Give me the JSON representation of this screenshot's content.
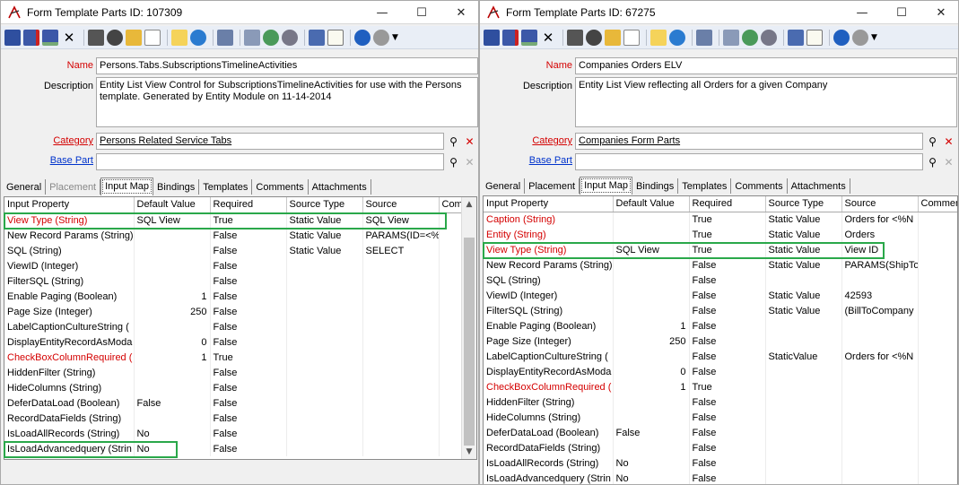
{
  "left": {
    "title": "Form Template Parts ID: 107309",
    "window_controls": {
      "minimize": "—",
      "maximize": "☐",
      "close": "✕"
    },
    "fields": {
      "name_label": "Name",
      "name_value": "Persons.Tabs.SubscriptionsTimelineActivities",
      "description_label": "Description",
      "description_value": "Entity List View Control for SubscriptionsTimelineActivities for use with the Persons template.  Generated by Entity Module on 11-14-2014",
      "category_label": "Category",
      "category_value": "Persons Related Service Tabs",
      "basepart_label": "Base Part",
      "basepart_value": ""
    },
    "tabs": [
      "General",
      "Placement",
      "Input Map",
      "Bindings",
      "Templates",
      "Comments",
      "Attachments"
    ],
    "active_tab": "Input Map",
    "columns": [
      "Input Property",
      "Default Value",
      "Required",
      "Source Type",
      "Source",
      "Com"
    ],
    "rows": [
      {
        "prop": "View Type (String)",
        "def": "SQL View",
        "req": "True",
        "stype": "Static Value",
        "src": "SQL View",
        "red": true
      },
      {
        "prop": "New Record Params (String)",
        "def": "",
        "req": "False",
        "stype": "Static Value",
        "src": "PARAMS(ID=<%",
        "red": false
      },
      {
        "prop": "SQL (String)",
        "def": "",
        "req": "False",
        "stype": "Static Value",
        "src": "SELECT",
        "red": false
      },
      {
        "prop": "ViewID (Integer)",
        "def": "",
        "req": "False",
        "stype": "",
        "src": "",
        "red": false
      },
      {
        "prop": "FilterSQL (String)",
        "def": "",
        "req": "False",
        "stype": "",
        "src": "",
        "red": false
      },
      {
        "prop": "Enable Paging (Boolean)",
        "def": "1",
        "req": "False",
        "stype": "",
        "src": "",
        "red": false,
        "num": true
      },
      {
        "prop": "Page Size (Integer)",
        "def": "250",
        "req": "False",
        "stype": "",
        "src": "",
        "red": false,
        "num": true
      },
      {
        "prop": "LabelCaptionCultureString (",
        "def": "",
        "req": "False",
        "stype": "",
        "src": "",
        "red": false
      },
      {
        "prop": "DisplayEntityRecordAsModa",
        "def": "0",
        "req": "False",
        "stype": "",
        "src": "",
        "red": false,
        "num": true
      },
      {
        "prop": "CheckBoxColumnRequired (",
        "def": "1",
        "req": "True",
        "stype": "",
        "src": "",
        "red": true,
        "num": true
      },
      {
        "prop": "HiddenFilter (String)",
        "def": "",
        "req": "False",
        "stype": "",
        "src": "",
        "red": false
      },
      {
        "prop": "HideColumns (String)",
        "def": "",
        "req": "False",
        "stype": "",
        "src": "",
        "red": false
      },
      {
        "prop": "DeferDataLoad (Boolean)",
        "def": "False",
        "req": "False",
        "stype": "",
        "src": "",
        "red": false
      },
      {
        "prop": "RecordDataFields (String)",
        "def": "",
        "req": "False",
        "stype": "",
        "src": "",
        "red": false
      },
      {
        "prop": "IsLoadAllRecords (String)",
        "def": "No",
        "req": "False",
        "stype": "",
        "src": "",
        "red": false
      },
      {
        "prop": "IsLoadAdvancedquery (Strin",
        "def": "No",
        "req": "False",
        "stype": "",
        "src": "",
        "red": false
      }
    ]
  },
  "right": {
    "title": "Form Template Parts ID: 67275",
    "window_controls": {
      "minimize": "—",
      "maximize": "☐",
      "close": "✕"
    },
    "fields": {
      "name_label": "Name",
      "name_value": "Companies Orders ELV",
      "description_label": "Description",
      "description_value": "Entity List View reflecting all Orders for a given Company",
      "category_label": "Category",
      "category_value": "Companies Form Parts",
      "basepart_label": "Base Part",
      "basepart_value": ""
    },
    "tabs": [
      "General",
      "Placement",
      "Input Map",
      "Bindings",
      "Templates",
      "Comments",
      "Attachments"
    ],
    "active_tab": "Input Map",
    "columns": [
      "Input Property",
      "Default Value",
      "Required",
      "Source Type",
      "Source",
      "Commer"
    ],
    "rows": [
      {
        "prop": "Caption (String)",
        "def": "",
        "req": "True",
        "stype": "Static Value",
        "src": "Orders for <%N",
        "red": true
      },
      {
        "prop": "Entity (String)",
        "def": "",
        "req": "True",
        "stype": "Static Value",
        "src": "Orders",
        "red": true
      },
      {
        "prop": "View Type (String)",
        "def": "SQL View",
        "req": "True",
        "stype": "Static Value",
        "src": "View ID",
        "red": true
      },
      {
        "prop": "New Record Params (String)",
        "def": "",
        "req": "False",
        "stype": "Static Value",
        "src": "PARAMS(ShipTo",
        "red": false
      },
      {
        "prop": "SQL (String)",
        "def": "",
        "req": "False",
        "stype": "",
        "src": "",
        "red": false
      },
      {
        "prop": "ViewID (Integer)",
        "def": "",
        "req": "False",
        "stype": "Static Value",
        "src": "42593",
        "red": false
      },
      {
        "prop": "FilterSQL (String)",
        "def": "",
        "req": "False",
        "stype": "Static Value",
        "src": "(BillToCompany",
        "red": false
      },
      {
        "prop": "Enable Paging (Boolean)",
        "def": "1",
        "req": "False",
        "stype": "",
        "src": "",
        "red": false,
        "num": true
      },
      {
        "prop": "Page Size (Integer)",
        "def": "250",
        "req": "False",
        "stype": "",
        "src": "",
        "red": false,
        "num": true
      },
      {
        "prop": "LabelCaptionCultureString (",
        "def": "",
        "req": "False",
        "stype": "StaticValue",
        "src": "Orders for <%N",
        "red": false
      },
      {
        "prop": "DisplayEntityRecordAsModa",
        "def": "0",
        "req": "False",
        "stype": "",
        "src": "",
        "red": false,
        "num": true
      },
      {
        "prop": "CheckBoxColumnRequired (",
        "def": "1",
        "req": "True",
        "stype": "",
        "src": "",
        "red": true,
        "num": true
      },
      {
        "prop": "HiddenFilter (String)",
        "def": "",
        "req": "False",
        "stype": "",
        "src": "",
        "red": false
      },
      {
        "prop": "HideColumns (String)",
        "def": "",
        "req": "False",
        "stype": "",
        "src": "",
        "red": false
      },
      {
        "prop": "DeferDataLoad (Boolean)",
        "def": "False",
        "req": "False",
        "stype": "",
        "src": "",
        "red": false
      },
      {
        "prop": "RecordDataFields (String)",
        "def": "",
        "req": "False",
        "stype": "",
        "src": "",
        "red": false
      },
      {
        "prop": "IsLoadAllRecords (String)",
        "def": "No",
        "req": "False",
        "stype": "",
        "src": "",
        "red": false
      },
      {
        "prop": "IsLoadAdvancedquery (Strin",
        "def": "No",
        "req": "False",
        "stype": "",
        "src": "",
        "red": false
      }
    ]
  },
  "colors": {
    "required_text": "#d40000",
    "highlight_box": "#2aa84a",
    "link_blue": "#0033cc",
    "toolbar_bg": "#e9eef6"
  },
  "toolbar_icons": [
    "save-icon",
    "save-close-icon",
    "save-new-icon",
    "delete-icon",
    "print-icon",
    "find-icon",
    "open-folder-icon",
    "list-icon",
    "wizard-icon",
    "refresh-icon",
    "link-icon",
    "copy-icon",
    "globe-icon",
    "gear-icon",
    "export-icon",
    "note-icon",
    "help-icon",
    "info-icon"
  ]
}
